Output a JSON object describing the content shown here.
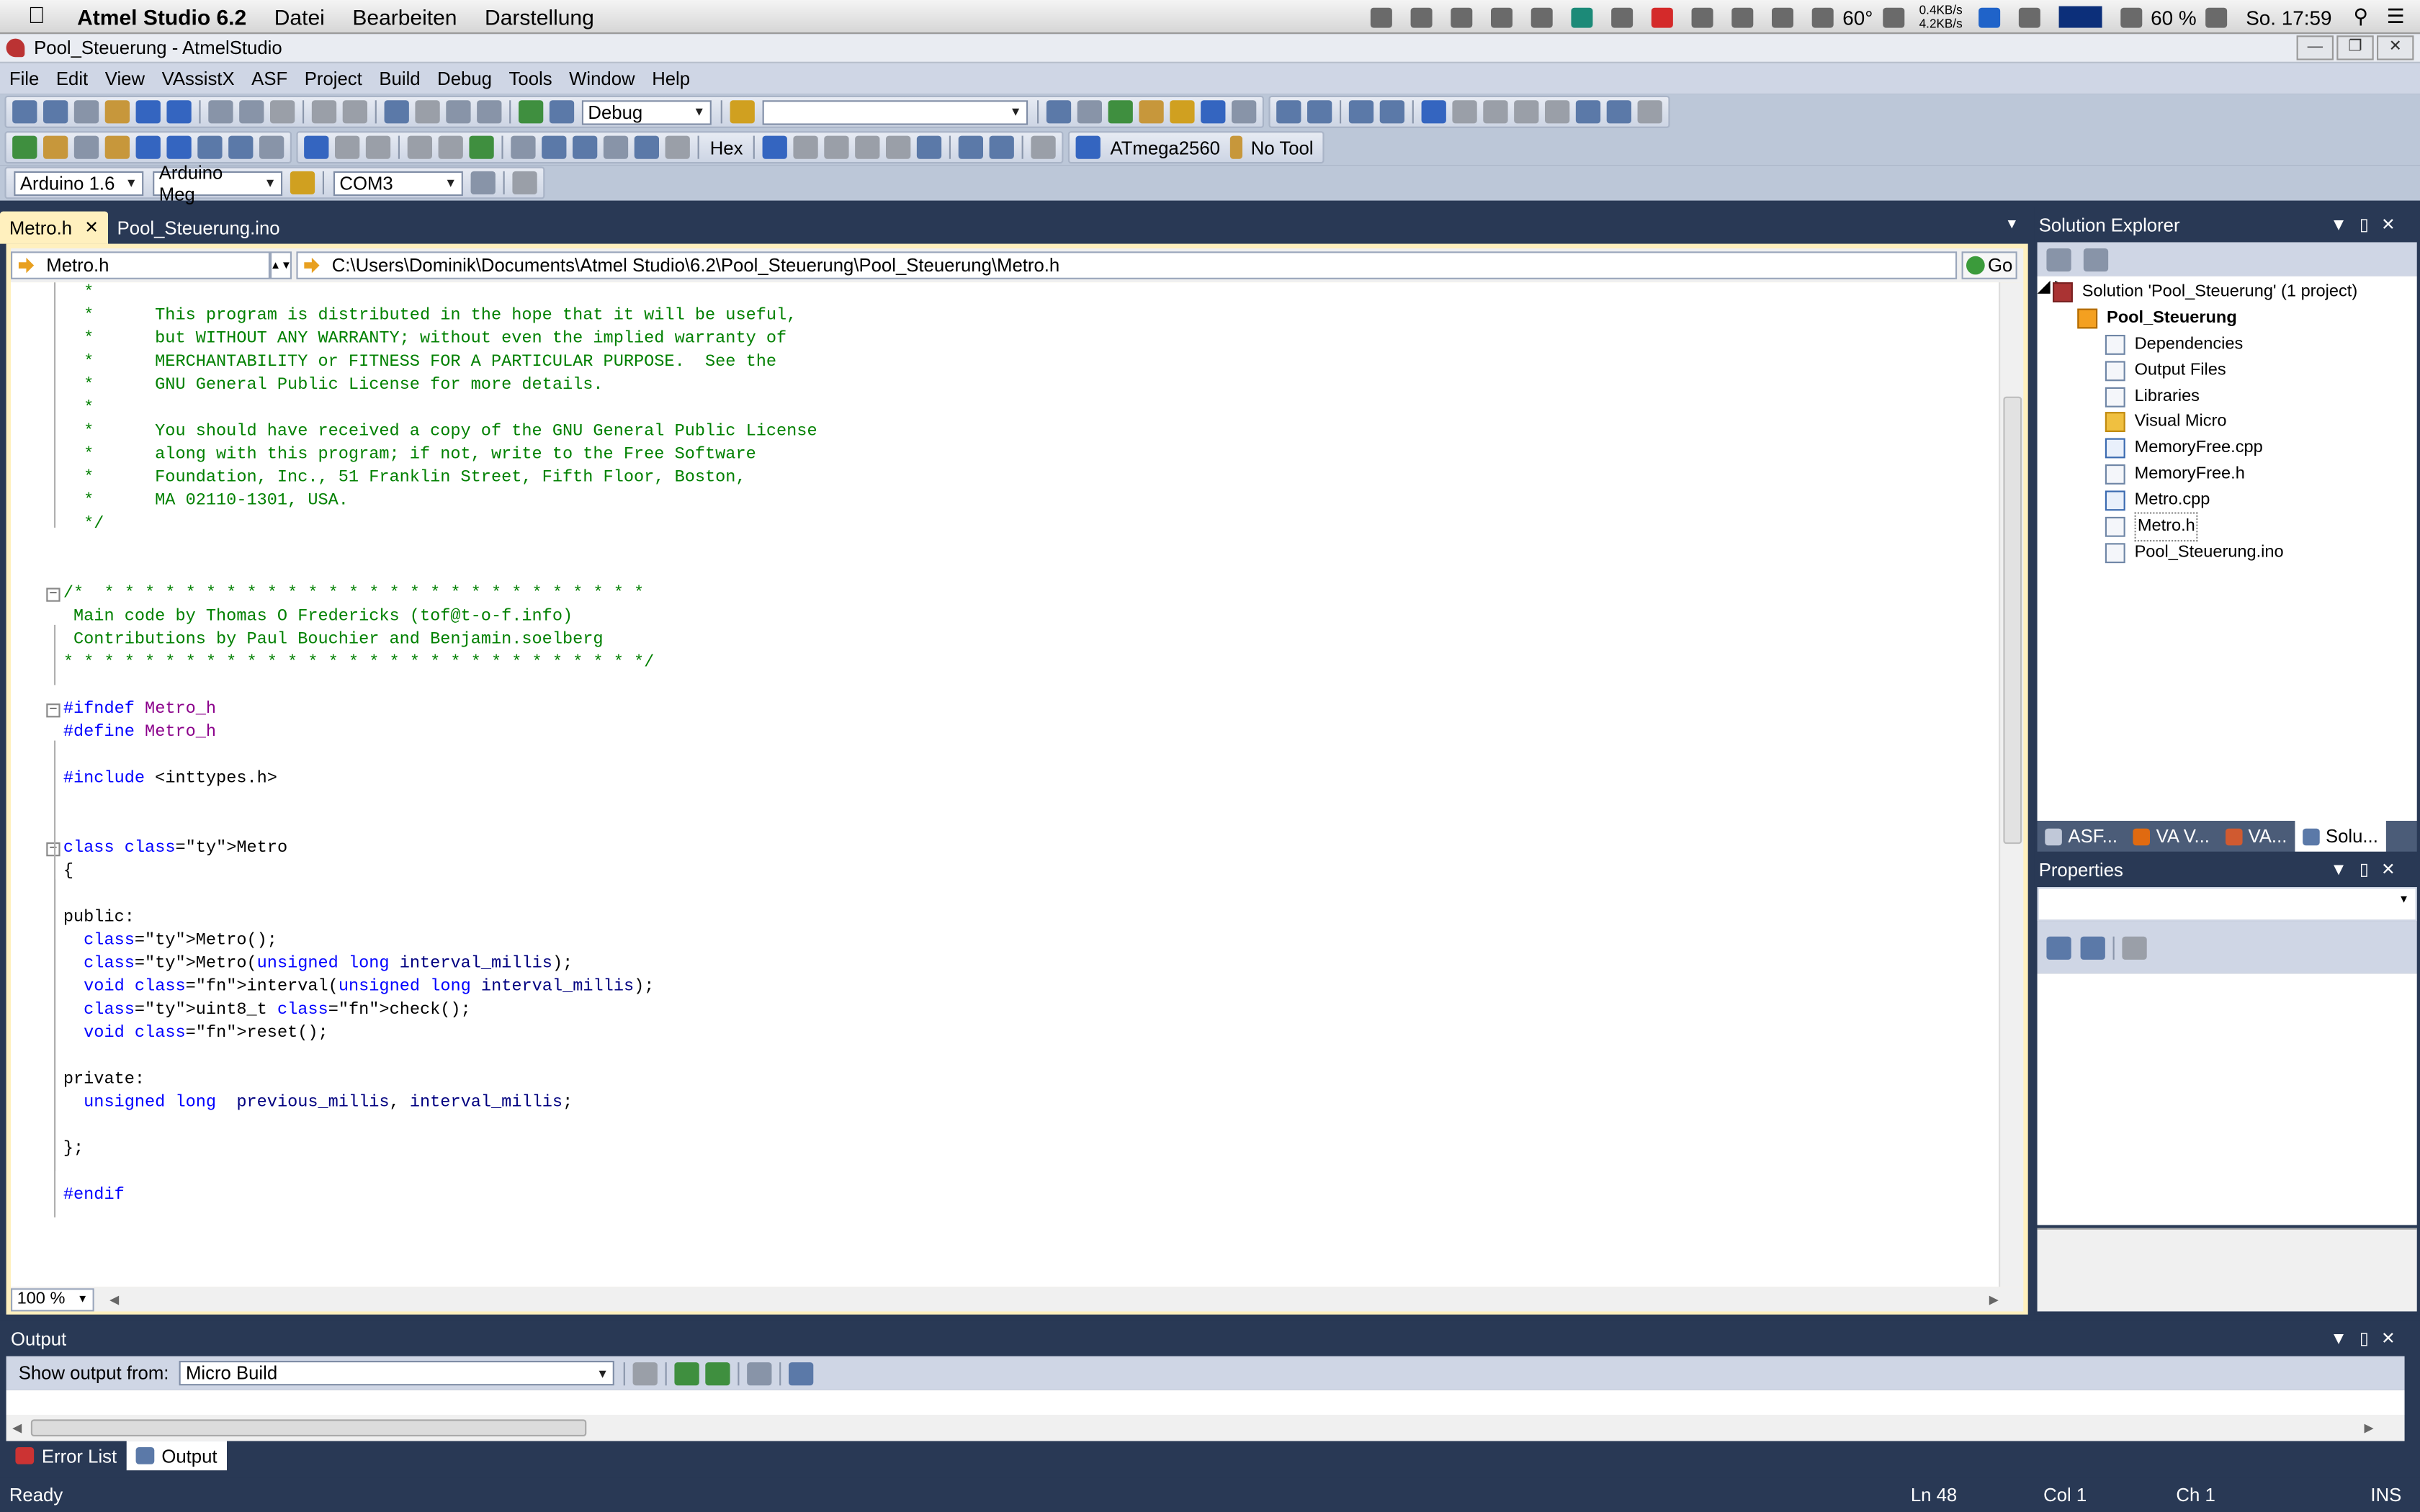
{
  "macos_menubar": {
    "app_name": "Atmel Studio 6.2",
    "menus": [
      "Datei",
      "Bearbeiten",
      "Darstellung"
    ],
    "temperature": "60°",
    "net_up": "0.4KB/s",
    "net_down": "4.2KB/s",
    "battery": "60 %",
    "clock": "So. 17:59"
  },
  "window": {
    "title": "Pool_Steuerung - AtmelStudio"
  },
  "menu": [
    "File",
    "Edit",
    "View",
    "VAssistX",
    "ASF",
    "Project",
    "Build",
    "Debug",
    "Tools",
    "Window",
    "Help"
  ],
  "toolbar": {
    "config": "Debug",
    "search": "",
    "hex_label": "Hex",
    "device": "ATmega2560",
    "tool": "No Tool",
    "board_version": "Arduino 1.6",
    "board": "Arduino Meg",
    "port": "COM3"
  },
  "editor": {
    "tabs": [
      {
        "label": "Metro.h",
        "active": true
      },
      {
        "label": "Pool_Steuerung.ino",
        "active": false
      }
    ],
    "nav_file": "Metro.h",
    "nav_path": "C:\\Users\\Dominik\\Documents\\Atmel Studio\\6.2\\Pool_Steuerung\\Pool_Steuerung\\Metro.h",
    "go_label": "Go",
    "zoom": "100 %",
    "code_lines": [
      "  *",
      "  *      This program is distributed in the hope that it will be useful,",
      "  *      but WITHOUT ANY WARRANTY; without even the implied warranty of",
      "  *      MERCHANTABILITY or FITNESS FOR A PARTICULAR PURPOSE.  See the",
      "  *      GNU General Public License for more details.",
      "  *",
      "  *      You should have received a copy of the GNU General Public License",
      "  *      along with this program; if not, write to the Free Software",
      "  *      Foundation, Inc., 51 Franklin Street, Fifth Floor, Boston,",
      "  *      MA 02110-1301, USA.",
      "  */",
      "",
      "",
      "/*  * * * * * * * * * * * * * * * * * * * * * * * * * * *",
      " Main code by Thomas O Fredericks (tof@t-o-f.info)",
      " Contributions by Paul Bouchier and Benjamin.soelberg",
      "* * * * * * * * * * * * * * * * * * * * * * * * * * * * */",
      "",
      "#ifndef Metro_h",
      "#define Metro_h",
      "",
      "#include <inttypes.h>",
      "",
      "",
      "class Metro",
      "{",
      "",
      "public:",
      "  Metro();",
      "  Metro(unsigned long interval_millis);",
      "  void interval(unsigned long interval_millis);",
      "  uint8_t check();",
      "  void reset();",
      "",
      "private:",
      "  unsigned long  previous_millis, interval_millis;",
      "",
      "};",
      "",
      "#endif"
    ]
  },
  "solution_explorer": {
    "title": "Solution Explorer",
    "solution": "Solution 'Pool_Steuerung' (1 project)",
    "project": "Pool_Steuerung",
    "items": [
      {
        "label": "Dependencies",
        "icon": "dependencies-icon"
      },
      {
        "label": "Output Files",
        "icon": "output-files-icon"
      },
      {
        "label": "Libraries",
        "icon": "libraries-icon"
      },
      {
        "label": "Visual Micro",
        "icon": "folder-icon"
      },
      {
        "label": "MemoryFree.cpp",
        "icon": "cpp-file-icon"
      },
      {
        "label": "MemoryFree.h",
        "icon": "header-file-icon"
      },
      {
        "label": "Metro.cpp",
        "icon": "cpp-file-icon"
      },
      {
        "label": "Metro.h",
        "icon": "header-file-icon"
      },
      {
        "label": "Pool_Steuerung.ino",
        "icon": "file-icon"
      }
    ],
    "tabs": [
      "ASF...",
      "VA V...",
      "VA...",
      "Solu..."
    ]
  },
  "properties": {
    "title": "Properties"
  },
  "output": {
    "title": "Output",
    "show_from_label": "Show output from:",
    "source": "Micro Build",
    "tabs": [
      "Error List",
      "Output"
    ]
  },
  "status": {
    "text": "Ready",
    "ln": "Ln 48",
    "col": "Col 1",
    "ch": "Ch 1",
    "mode": "INS"
  },
  "colors": {
    "ide_background": "#293955",
    "active_tab": "#fff0be",
    "comment": "#008000",
    "keyword": "#0000ff",
    "macro": "#8b008b"
  }
}
